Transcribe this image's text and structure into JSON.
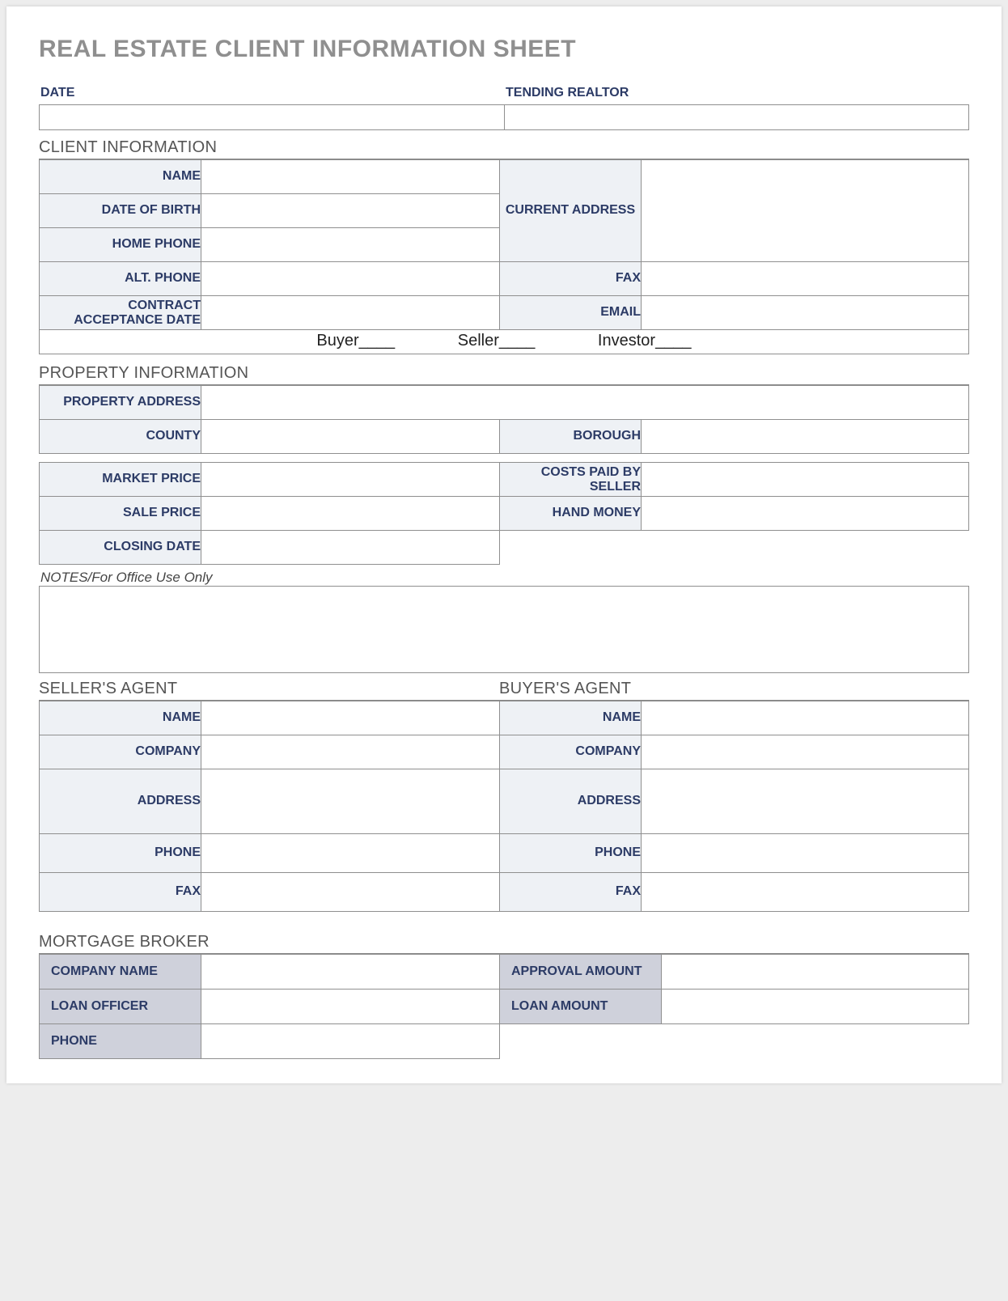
{
  "title": "REAL ESTATE CLIENT INFORMATION SHEET",
  "top": {
    "date_label": "DATE",
    "date_value": "",
    "realtor_label": "TENDING REALTOR",
    "realtor_value": ""
  },
  "sections": {
    "client_info": "CLIENT INFORMATION",
    "property_info": "PROPERTY INFORMATION",
    "notes": "NOTES/For Office Use Only",
    "sellers_agent": "SELLER'S AGENT",
    "buyers_agent": "BUYER'S AGENT",
    "mortgage_broker": "MORTGAGE BROKER"
  },
  "client": {
    "name_label": "NAME",
    "name_value": "",
    "dob_label": "DATE OF BIRTH",
    "dob_value": "",
    "home_phone_label": "HOME PHONE",
    "home_phone_value": "",
    "alt_phone_label": "ALT. PHONE",
    "alt_phone_value": "",
    "contract_date_label": "CONTRACT ACCEPTANCE DATE",
    "contract_date_value": "",
    "current_address_label": "CURRENT ADDRESS",
    "current_address_value": "",
    "fax_label": "FAX",
    "fax_value": "",
    "email_label": "EMAIL",
    "email_value": ""
  },
  "roles": {
    "buyer": "Buyer____",
    "seller": "Seller____",
    "investor": "Investor____"
  },
  "property": {
    "address_label": "PROPERTY ADDRESS",
    "address_value": "",
    "county_label": "COUNTY",
    "county_value": "",
    "borough_label": "BOROUGH",
    "borough_value": "",
    "market_price_label": "MARKET PRICE",
    "market_price_value": "",
    "costs_by_seller_label": "COSTS PAID BY SELLER",
    "costs_by_seller_value": "",
    "sale_price_label": "SALE PRICE",
    "sale_price_value": "",
    "hand_money_label": "HAND MONEY",
    "hand_money_value": "",
    "closing_date_label": "CLOSING DATE",
    "closing_date_value": ""
  },
  "notes_value": "",
  "seller_agent": {
    "name_label": "NAME",
    "name_value": "",
    "company_label": "COMPANY",
    "company_value": "",
    "address_label": "ADDRESS",
    "address_value": "",
    "phone_label": "PHONE",
    "phone_value": "",
    "fax_label": "FAX",
    "fax_value": ""
  },
  "buyer_agent": {
    "name_label": "NAME",
    "name_value": "",
    "company_label": "COMPANY",
    "company_value": "",
    "address_label": "ADDRESS",
    "address_value": "",
    "phone_label": "PHONE",
    "phone_value": "",
    "fax_label": "FAX",
    "fax_value": ""
  },
  "mortgage": {
    "company_label": "COMPANY NAME",
    "company_value": "",
    "approval_label": "APPROVAL AMOUNT",
    "approval_value": "",
    "officer_label": "LOAN OFFICER",
    "officer_value": "",
    "loan_amount_label": "LOAN AMOUNT",
    "loan_amount_value": "",
    "phone_label": "PHONE",
    "phone_value": ""
  }
}
